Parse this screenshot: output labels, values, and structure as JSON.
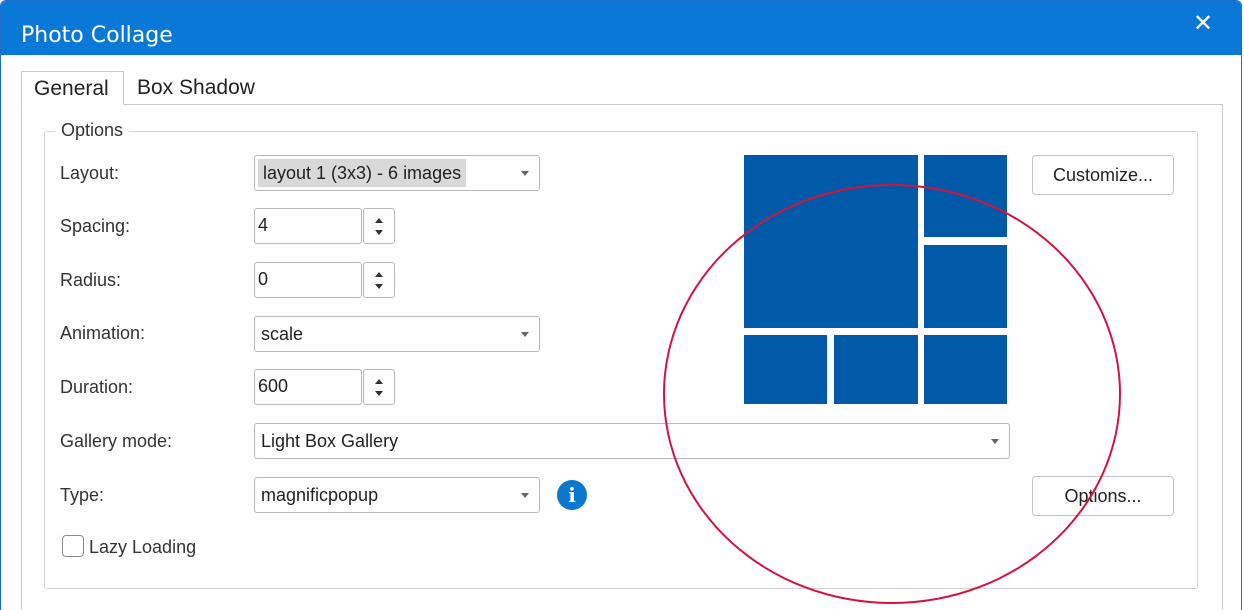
{
  "window": {
    "title": "Photo Collage"
  },
  "tabs": [
    {
      "label": "General"
    },
    {
      "label": "Box Shadow"
    }
  ],
  "options": {
    "group_label": "Options",
    "layout": {
      "label": "Layout:",
      "value": "layout 1 (3x3) - 6 images"
    },
    "spacing": {
      "label": "Spacing:",
      "value": "4"
    },
    "radius": {
      "label": "Radius:",
      "value": "0"
    },
    "animation": {
      "label": "Animation:",
      "value": "scale"
    },
    "duration": {
      "label": "Duration:",
      "value": "600"
    },
    "gallery_mode": {
      "label": "Gallery mode:",
      "value": "Light Box Gallery"
    },
    "type": {
      "label": "Type:",
      "value": "magnificpopup"
    },
    "lazy_loading": {
      "label": "Lazy Loading",
      "checked": false
    }
  },
  "buttons": {
    "customize": "Customize...",
    "options": "Options..."
  },
  "colors": {
    "accent": "#0a78d7",
    "tile": "#005aa7",
    "highlight_circle": "#d2153f"
  }
}
